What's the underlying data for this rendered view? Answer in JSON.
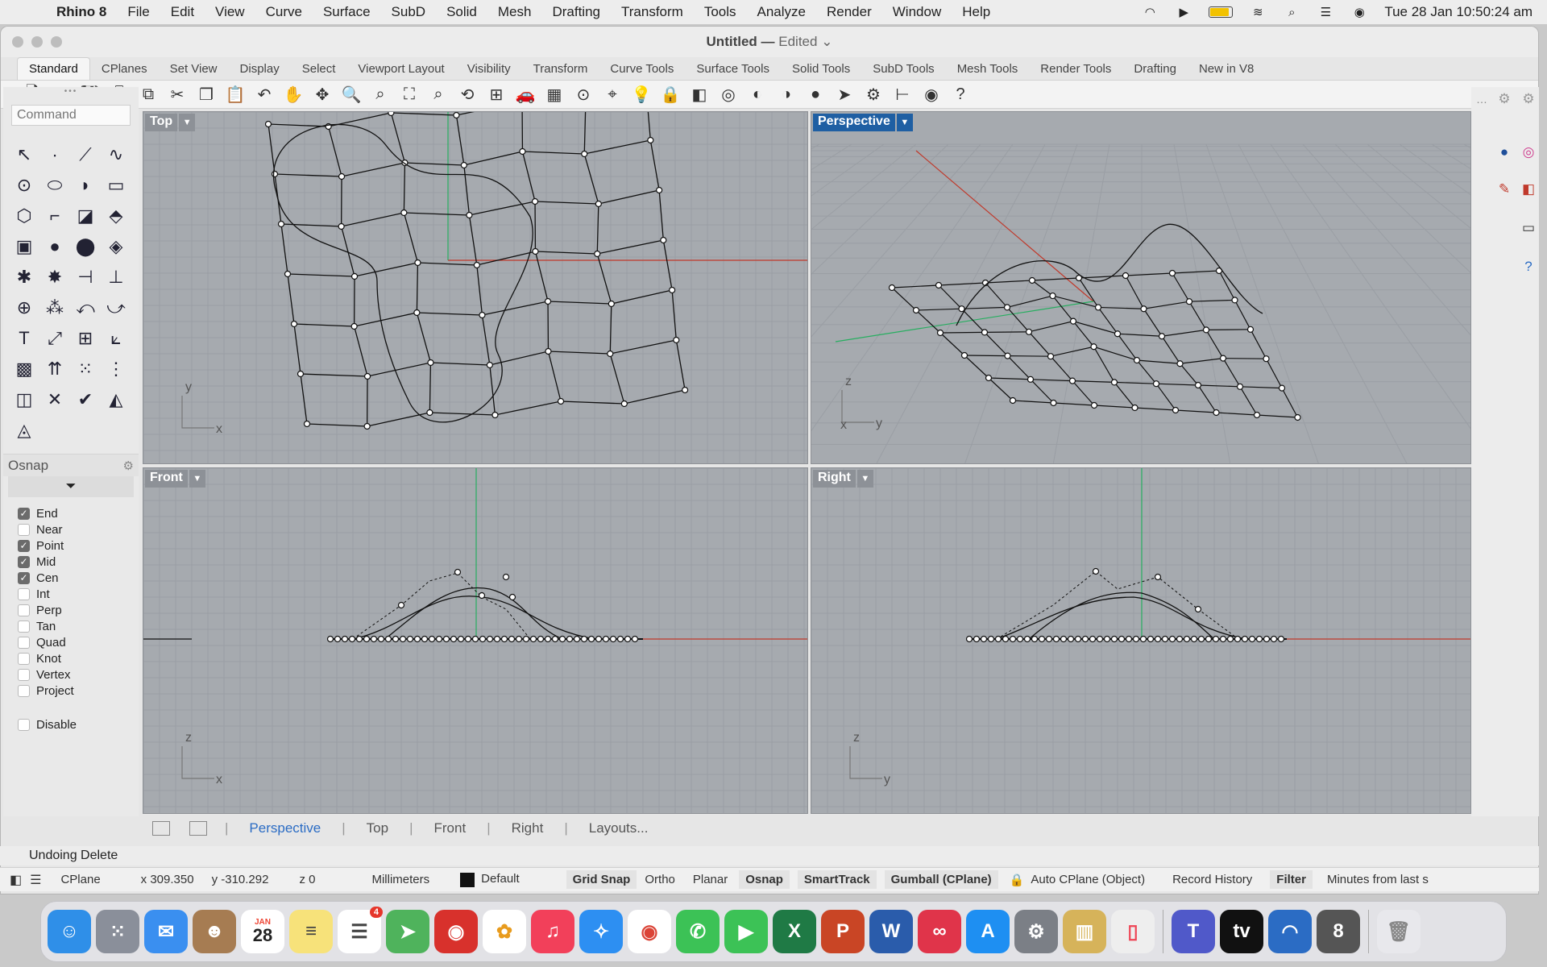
{
  "menubar": {
    "items": [
      "Rhino 8",
      "File",
      "Edit",
      "View",
      "Curve",
      "Surface",
      "SubD",
      "Solid",
      "Mesh",
      "Drafting",
      "Transform",
      "Tools",
      "Analyze",
      "Render",
      "Window",
      "Help"
    ],
    "clock": "Tue 28 Jan  10:50:24 am"
  },
  "window": {
    "title": "Untitled —",
    "edited": "Edited"
  },
  "tabs": [
    "Standard",
    "CPlanes",
    "Set View",
    "Display",
    "Select",
    "Viewport Layout",
    "Visibility",
    "Transform",
    "Curve Tools",
    "Surface Tools",
    "Solid Tools",
    "SubD Tools",
    "Mesh Tools",
    "Render Tools",
    "Drafting",
    "New in V8"
  ],
  "toolbar_icons": [
    "new-file-icon",
    "open-icon",
    "save-icon",
    "print-icon",
    "export-icon",
    "cut-icon",
    "copy-icon",
    "paste-icon",
    "undo-icon",
    "pan-icon",
    "rotate-view-icon",
    "zoom-icon",
    "zoom-window-icon",
    "zoom-extents-icon",
    "zoom-selected-icon",
    "undo-view-icon",
    "four-viewports-icon",
    "car-icon",
    "grid-icon",
    "cplane-icon",
    "osnap-icon",
    "light-icon",
    "lock-icon",
    "layer-icon",
    "color-wheel-icon",
    "shaded-icon",
    "rendered-icon",
    "render-sphere-icon",
    "select-icon",
    "gear-icon",
    "dims-icon",
    "sphere-icon",
    "help-icon"
  ],
  "command": {
    "placeholder": "Command"
  },
  "osnap": {
    "title": "Osnap",
    "items": [
      {
        "label": "End",
        "checked": true
      },
      {
        "label": "Near",
        "checked": false
      },
      {
        "label": "Point",
        "checked": true
      },
      {
        "label": "Mid",
        "checked": true
      },
      {
        "label": "Cen",
        "checked": true
      },
      {
        "label": "Int",
        "checked": false
      },
      {
        "label": "Perp",
        "checked": false
      },
      {
        "label": "Tan",
        "checked": false
      },
      {
        "label": "Quad",
        "checked": false
      },
      {
        "label": "Knot",
        "checked": false
      },
      {
        "label": "Vertex",
        "checked": false
      },
      {
        "label": "Project",
        "checked": false
      }
    ],
    "disable": "Disable"
  },
  "viewports": {
    "top": {
      "name": "Top",
      "ax1": "y",
      "ax2": "x"
    },
    "perspective": {
      "name": "Perspective",
      "ax1": "z",
      "ax2": "y",
      "ax3": "x"
    },
    "front": {
      "name": "Front",
      "ax1": "z",
      "ax2": "x"
    },
    "right": {
      "name": "Right",
      "ax1": "z",
      "ax2": "y"
    }
  },
  "viewport_tabs": [
    "Perspective",
    "Top",
    "Front",
    "Right",
    "Layouts..."
  ],
  "prompt": "Undoing Delete",
  "status": {
    "cplane": "CPlane",
    "x": "x 309.350",
    "y": "y -310.292",
    "z": "z 0",
    "units": "Millimeters",
    "layer": "Default",
    "grid_snap": "Grid Snap",
    "ortho": "Ortho",
    "planar": "Planar",
    "osnap": "Osnap",
    "smarttrack": "SmartTrack",
    "gumball": "Gumball (CPlane)",
    "auto_cplane": "Auto CPlane (Object)",
    "record_history": "Record History",
    "filter": "Filter",
    "minutes": "Minutes from last s"
  },
  "dock": {
    "calendar_month": "JAN",
    "calendar_day": "28",
    "reminders_badge": "4",
    "apps": [
      "finder",
      "launchpad",
      "mail",
      "contacts",
      "calendar",
      "notes",
      "reminders",
      "maps",
      "photo-booth",
      "photos",
      "music",
      "safari",
      "chrome",
      "messages",
      "facetime",
      "excel",
      "powerpoint",
      "word",
      "creative-cloud",
      "app-store",
      "system-settings",
      "archive-utility",
      "iphone-mirroring",
      "teams",
      "apple-tv",
      "rhino-wip",
      "rhino-8",
      "trash"
    ]
  },
  "colors": {
    "accent": "#1f5fa3",
    "viewport_bg": "#a6aaaf",
    "axis_red": "#c0392b",
    "axis_green": "#27ae60"
  }
}
